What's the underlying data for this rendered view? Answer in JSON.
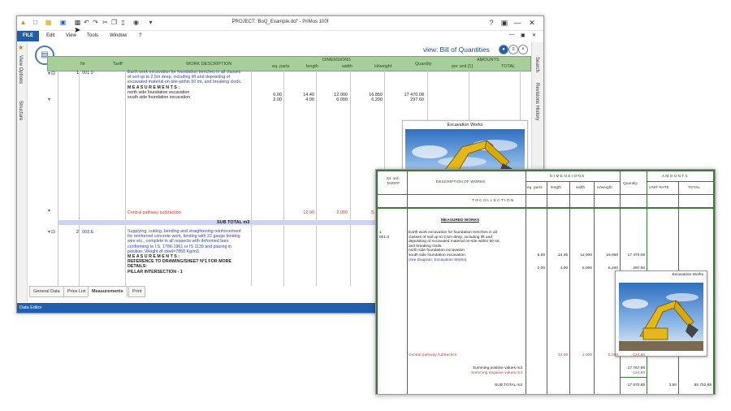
{
  "window": {
    "title": "PROJECT: 'BoQ_Example.dcf' - PriMus  100f",
    "menu": [
      "FILE",
      "Edit",
      "View",
      "Tools",
      "Window",
      "?"
    ],
    "view_prefix": "view:",
    "view_name": "Bill of Quantities"
  },
  "left_tabs": [
    "View Options",
    "Structure"
  ],
  "right_tabs": [
    "Search",
    "Revisions History"
  ],
  "table": {
    "headers": {
      "nr": "Nr",
      "tariff": "Tariff",
      "work_description": "WORK DESCRIPTION",
      "dimensions": "DIMENSIONS",
      "eq_parts": "eq. parts",
      "length": "length",
      "width": "width",
      "hweight": "H/weight",
      "quantity": "Quantity",
      "amounts": "AMOUNTS",
      "per_unit": "per unit [1]",
      "total": "TOTAL"
    },
    "row1": {
      "nr": "1",
      "tariff": "001.0",
      "desc_lines": [
        "Earth work excavation for foundation trenches in all classes",
        "of soil up to 2,5m deep, including lift and depositing of",
        "excavated material on-site within 50 mt, and breaking clods."
      ],
      "measurements": "M E A S U R E M E N T S :",
      "items": [
        {
          "label": "north side foundation excavation",
          "parts": "6.00",
          "length": "14.40",
          "width": "12.000",
          "hweight": "16.850",
          "qty": "17 470.08"
        },
        {
          "label": "south side foundation excavation",
          "parts": "2.00",
          "length": "4.00",
          "width": "6.000",
          "hweight": "6.200",
          "qty": "297.60"
        }
      ],
      "subtraction": {
        "label": "Central pathway subtraction",
        "length": "12.00",
        "width": "2.000",
        "hweight": "5.200"
      }
    },
    "subtotal_label": "SUB TOTAL m3",
    "row2": {
      "nr": "2",
      "tariff": "003.E",
      "desc_lines": [
        "Supplying, cutting, bending and straightening reinforcement",
        "for reinforced concrete work, binding with 22 gauge binding",
        "wire etc., complete in all respects with deformed bars",
        "conforming to I.S. 1786-1961 or IS 1139 and placing in",
        "position. Weight of steel=7850 Kg/m3."
      ],
      "bold_lines": [
        "M E A S U R E M E N T S :",
        "REFERENCE TO DRAWING/SHEET N°1 FOR MORE",
        "DETAILS:",
        "PILLAR INTERSECTION - 1"
      ]
    }
  },
  "popup": {
    "title": "Excavation Works"
  },
  "bottom_tabs": [
    "General Data",
    "Price List",
    "Measurements",
    "Print"
  ],
  "active_tab": "Measurements",
  "status": "Data Editor",
  "preview": {
    "headers": {
      "nr": "Nr. ord.\nTARIFF",
      "desc": "DESCRIPTION OF WORKS",
      "dimensions": "D I M E N S I O N S",
      "eq_parts": "eq. parts",
      "length": "length",
      "width": "width",
      "hweight": "H/weight",
      "quantity": "Quantity",
      "amounts": "A M O U N T S",
      "unit_rate": "UNIT RATE",
      "total": "TOTAL"
    },
    "carry": "T O   C O L L E C T I O N",
    "section": "MEASURED WORKS",
    "nr": "1",
    "tariff": "001.0",
    "desc_lines": [
      "Earth work excavation for foundation trenches in all",
      "classes of soil up to 2,5m deep, including lift and",
      "depositing of excavated material on-site within 50 mt,",
      "and breaking clods."
    ],
    "items": [
      {
        "label": "north side foundation excavation",
        "parts": "6,00",
        "length": "14,40",
        "width": "12,000",
        "hweight": "16,850",
        "qty": "17 470,08"
      },
      {
        "label": "south side foundation excavation",
        "parts": "2,00",
        "length": "4,00",
        "width": "6,000",
        "hweight": "6,200",
        "qty": "297,60"
      }
    ],
    "link": "(see Diagram: Excavation Works)",
    "image_title": "Excavation Works",
    "subtraction": {
      "label": "Central pathway subtraction",
      "length": "12,00",
      "width": "2,000",
      "hweight": "5,200",
      "qty": "-124,80"
    },
    "pos_label": "Summing positive values m3",
    "pos_value": "17 767,68",
    "neg_label": "Summing negative values m3",
    "neg_value": "-124,80",
    "subtotal_label": "SUB TOTAL m3",
    "subtotal_qty": "17 570,88",
    "unit_rate": "3,50",
    "total": "55 752,98"
  }
}
